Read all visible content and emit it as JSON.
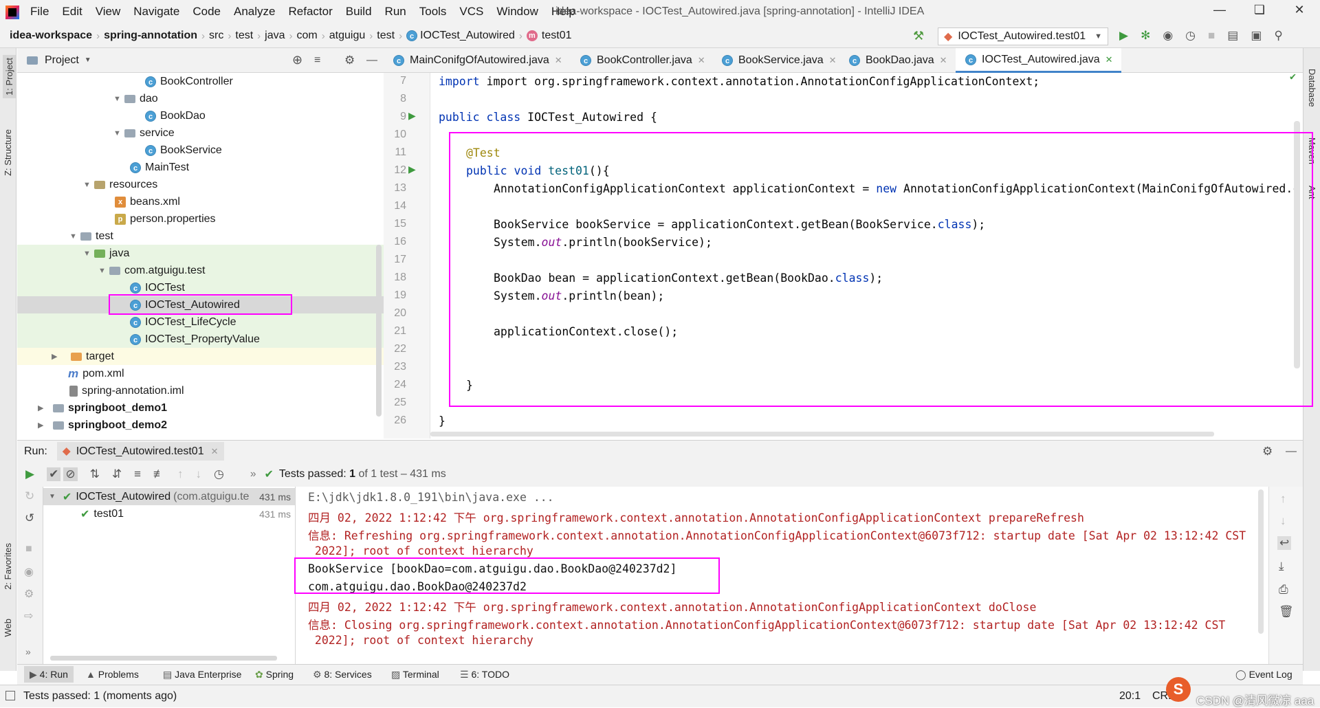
{
  "window": {
    "title": "idea-workspace - IOCTest_Autowired.java [spring-annotation] - IntelliJ IDEA",
    "menu": [
      "File",
      "Edit",
      "View",
      "Navigate",
      "Code",
      "Analyze",
      "Refactor",
      "Build",
      "Run",
      "Tools",
      "VCS",
      "Window",
      "Help"
    ]
  },
  "breadcrumb": [
    "idea-workspace",
    "spring-annotation",
    "src",
    "test",
    "java",
    "com",
    "atguigu",
    "test",
    "IOCTest_Autowired",
    "test01"
  ],
  "run_config": "IOCTest_Autowired.test01",
  "project_panel": {
    "title": "Project",
    "tree": [
      {
        "label": "BookController",
        "icon": "class-icon"
      },
      {
        "label": "dao",
        "icon": "package-icon"
      },
      {
        "label": "BookDao",
        "icon": "class-icon"
      },
      {
        "label": "service",
        "icon": "package-icon"
      },
      {
        "label": "BookService",
        "icon": "class-icon"
      },
      {
        "label": "MainTest",
        "icon": "runnable-class-icon"
      },
      {
        "label": "resources",
        "icon": "resources-folder-icon"
      },
      {
        "label": "beans.xml",
        "icon": "xml-file-icon"
      },
      {
        "label": "person.properties",
        "icon": "properties-file-icon"
      },
      {
        "label": "test",
        "icon": "folder-icon"
      },
      {
        "label": "java",
        "icon": "test-sources-folder-icon"
      },
      {
        "label": "com.atguigu.test",
        "icon": "package-icon"
      },
      {
        "label": "IOCTest",
        "icon": "test-class-icon"
      },
      {
        "label": "IOCTest_Autowired",
        "icon": "test-class-icon"
      },
      {
        "label": "IOCTest_LifeCycle",
        "icon": "test-class-icon"
      },
      {
        "label": "IOCTest_PropertyValue",
        "icon": "test-class-icon"
      },
      {
        "label": "target",
        "icon": "excluded-folder-icon"
      },
      {
        "label": "pom.xml",
        "icon": "maven-icon"
      },
      {
        "label": "spring-annotation.iml",
        "icon": "iml-file-icon"
      },
      {
        "label": "springboot_demo1",
        "icon": "module-icon"
      },
      {
        "label": "springboot_demo2",
        "icon": "module-icon"
      }
    ]
  },
  "editor": {
    "tabs": [
      "MainConifgOfAutowired.java",
      "BookController.java",
      "BookService.java",
      "BookDao.java",
      "IOCTest_Autowired.java"
    ],
    "active_tab": "IOCTest_Autowired.java",
    "line_numbers": [
      "7",
      "8",
      "9",
      "10",
      "11",
      "12",
      "13",
      "14",
      "15",
      "16",
      "17",
      "18",
      "19",
      "20",
      "21",
      "22",
      "23",
      "24",
      "25",
      "26"
    ],
    "code": {
      "l7": "import org.springframework.context.annotation.AnnotationConfigApplicationContext;",
      "l9a": "public class ",
      "l9b": "IOCTest_Autowired {",
      "l11": "@Test",
      "l12a": "public void ",
      "l12b": "test01",
      "l12c": "(){",
      "l13a": "AnnotationConfigApplicationContext applicationContext = ",
      "l13b": "new ",
      "l13c": "AnnotationConfigApplicationContext(MainConifgOfAutowired.c",
      "l15a": "BookService bookService = applicationContext.getBean(BookService.",
      "l15b": "class",
      "l15c": ");",
      "l16a": "System.",
      "l16b": "out",
      "l16c": ".println(bookService);",
      "l18a": "BookDao bean = applicationContext.getBean(BookDao.",
      "l18b": "class",
      "l18c": ");",
      "l19a": "System.",
      "l19b": "out",
      "l19c": ".println(bean);",
      "l21": "applicationContext.close();",
      "l24": "}",
      "l26": "}"
    }
  },
  "run_panel": {
    "label": "Run:",
    "tab": "IOCTest_Autowired.test01",
    "status_prefix": "Tests passed:",
    "status_count": "1",
    "status_suffix": "of 1 test – 431 ms",
    "test_tree": [
      {
        "label": "IOCTest_Autowired",
        "detail": "(com.atguigu.te",
        "time": "431 ms"
      },
      {
        "label": "test01",
        "detail": "",
        "time": "431 ms"
      }
    ],
    "console": [
      {
        "text": "E:\\jdk\\jdk1.8.0_191\\bin\\java.exe ...",
        "color": "gray"
      },
      {
        "text": "四月 02, 2022 1:12:42 下午 org.springframework.context.annotation.AnnotationConfigApplicationContext prepareRefresh",
        "color": "red"
      },
      {
        "text": "信息: Refreshing org.springframework.context.annotation.AnnotationConfigApplicationContext@6073f712: startup date [Sat Apr 02 13:12:42 CST",
        "color": "red"
      },
      {
        "text": " 2022]; root of context hierarchy",
        "color": "red"
      },
      {
        "text": "BookService [bookDao=com.atguigu.dao.BookDao@240237d2]",
        "color": "black"
      },
      {
        "text": "com.atguigu.dao.BookDao@240237d2",
        "color": "black"
      },
      {
        "text": "四月 02, 2022 1:12:42 下午 org.springframework.context.annotation.AnnotationConfigApplicationContext doClose",
        "color": "red"
      },
      {
        "text": "信息: Closing org.springframework.context.annotation.AnnotationConfigApplicationContext@6073f712: startup date [Sat Apr 02 13:12:42 CST",
        "color": "red"
      },
      {
        "text": " 2022]; root of context hierarchy",
        "color": "red"
      }
    ]
  },
  "bottom_tabs": {
    "run": "4: Run",
    "problems": "Problems",
    "java_enterprise": "Java Enterprise",
    "spring": "Spring",
    "services": "8: Services",
    "terminal": "Terminal",
    "todo": "6: TODO",
    "event_log": "Event Log"
  },
  "side_tools": {
    "project": "1: Project",
    "structure": "Z: Structure",
    "favorites": "2: Favorites",
    "web": "Web",
    "database": "Database",
    "maven": "Maven",
    "ant": "Ant"
  },
  "status_bar": {
    "message": "Tests passed: 1 (moments ago)",
    "position": "20:1",
    "encoding": "CRLF",
    "watermark": "CSDN @清风微凉 aaa"
  }
}
